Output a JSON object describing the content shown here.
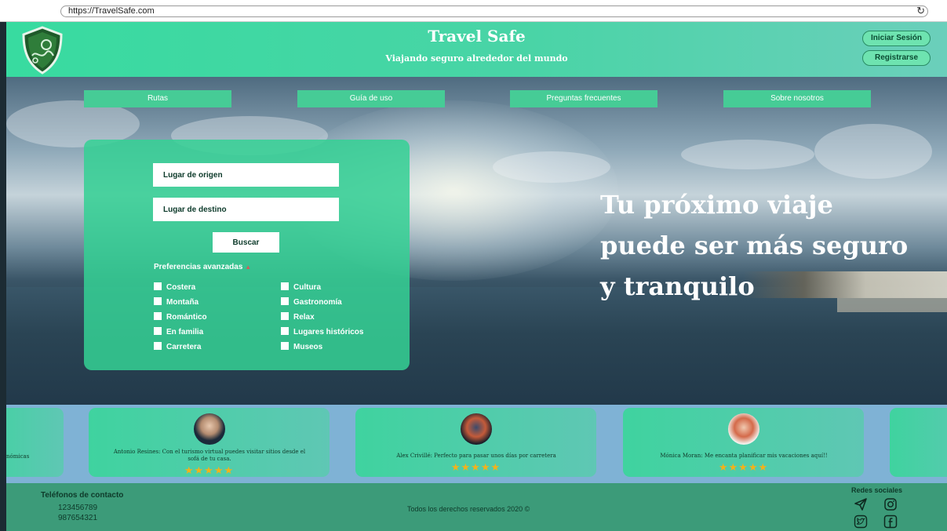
{
  "browser": {
    "url": "https://TravelSafe.com",
    "reload_glyph": "↻"
  },
  "header": {
    "title": "Travel Safe",
    "subtitle": "Viajando seguro alrededor del mundo",
    "login_label": "Iniciar Sesión",
    "register_label": "Registrarse",
    "logo_icon": "shield-map-icon"
  },
  "nav": [
    {
      "label": "Rutas"
    },
    {
      "label": "Guía de uso"
    },
    {
      "label": "Preguntas frecuentes"
    },
    {
      "label": "Sobre nosotros"
    }
  ],
  "search": {
    "origin_placeholder": "Lugar de origen",
    "destination_placeholder": "Lugar de destino",
    "button_label": "Buscar",
    "prefs_label": "Preferencias avanzadas",
    "prefs_arrow": "▲",
    "prefs_left": [
      "Costera",
      "Montaña",
      "Romántico",
      "En familia",
      "Carretera"
    ],
    "prefs_right": [
      "Cultura",
      "Gastronomía",
      "Relax",
      "Lugares históricos",
      "Museos"
    ]
  },
  "hero": {
    "line1": "Tu próximo viaje",
    "line2": "puede ser más seguro",
    "line3": "y tranquilo"
  },
  "reviews": {
    "partial_left_text": "nómicas",
    "items": [
      {
        "text": "Antonio Resines: Con el turismo virtual puedes visitar sitios desde el sofá de tu casa.",
        "rating": 5,
        "stars": "★★★★★"
      },
      {
        "text": "Alex Crivillé: Perfecto para pasar unos días por carretera",
        "rating": 5,
        "stars": "★★★★★"
      },
      {
        "text": "Mónica Moran: Me encanta planificar mis vacaciones aquí!!",
        "rating": 5,
        "stars": "★★★★★"
      }
    ]
  },
  "footer": {
    "contact_title": "Teléfonos de contacto",
    "phones": [
      "123456789",
      "987654321"
    ],
    "copyright": "Todos los derechos reservados 2020 ©",
    "social_title": "Redes sociales",
    "social_icons": [
      "telegram-icon",
      "instagram-icon",
      "twitter-icon",
      "facebook-icon"
    ]
  },
  "colors": {
    "brand": "#38dba0",
    "panel": "#34d094",
    "footer": "#3c9b79",
    "reviews_bg": "#7fb2d5",
    "star": "#f2b21b"
  }
}
